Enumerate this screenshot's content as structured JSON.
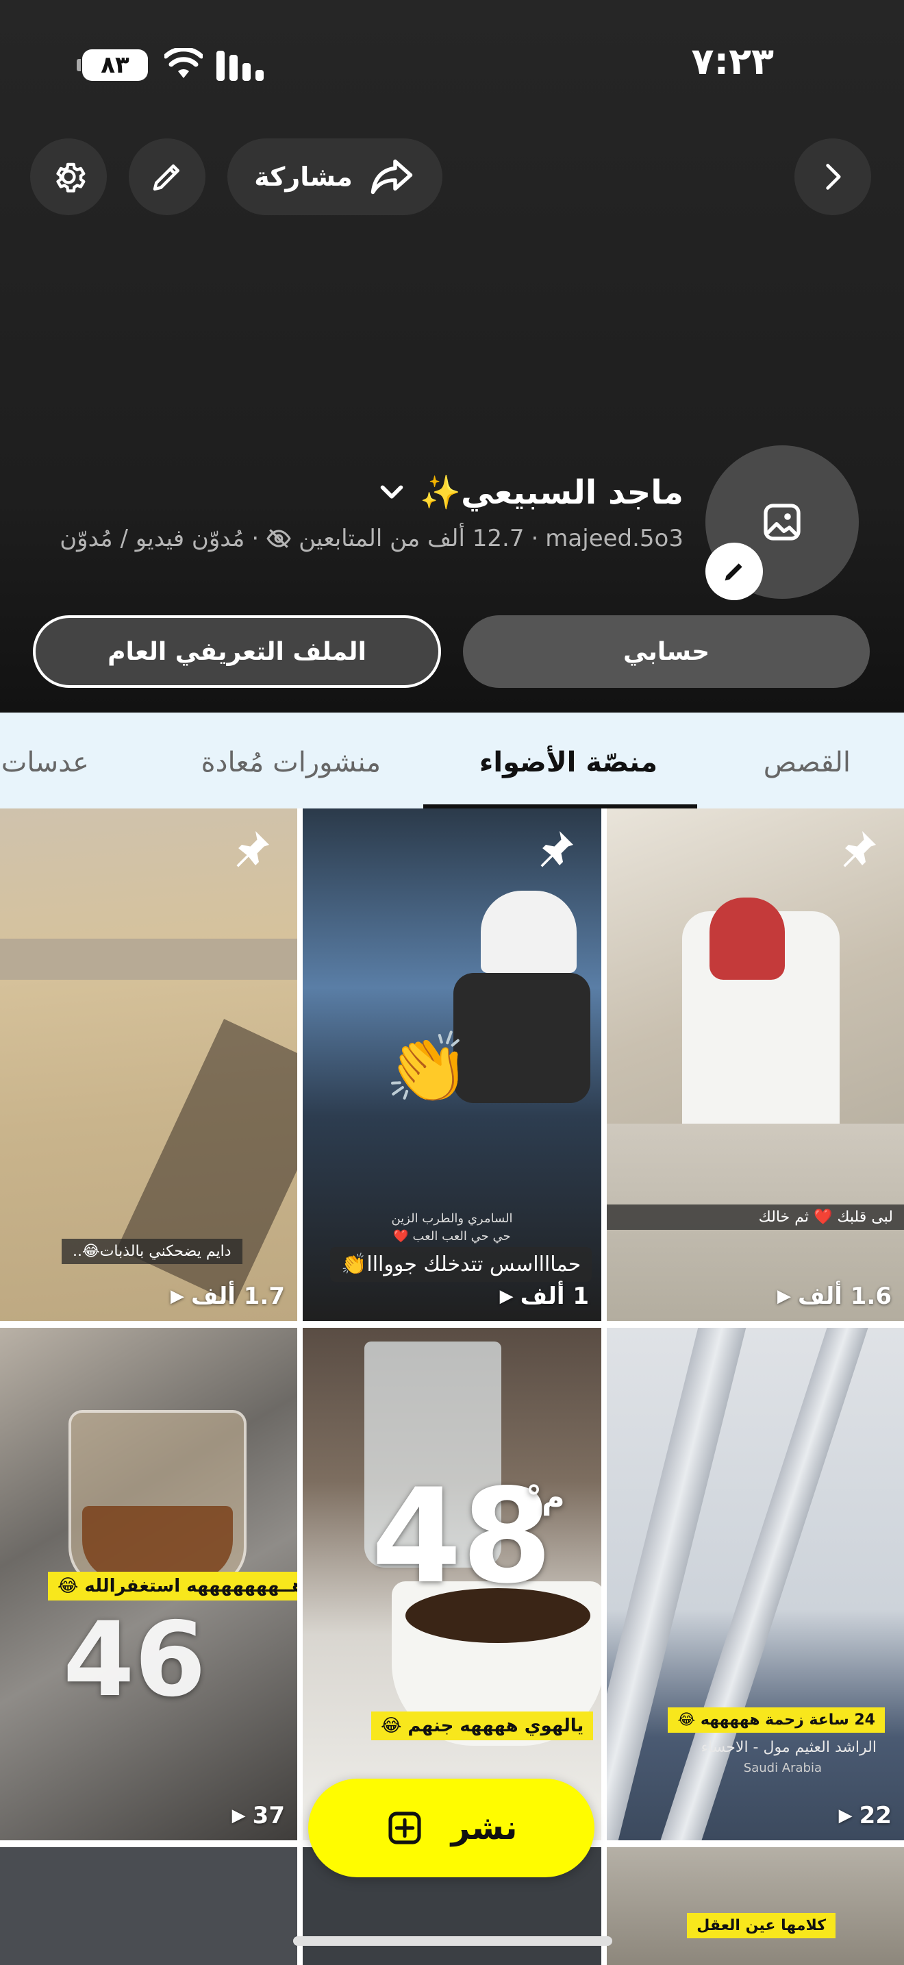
{
  "status_bar": {
    "time": "٧:٢٣",
    "battery": "٨٣"
  },
  "top_actions": {
    "share_label": "مشاركة"
  },
  "profile": {
    "name": "ماجد السبيعي✨",
    "username": "majeed.5o3",
    "followers": "12.7 ألف من المتابعين",
    "category": "مُدوّن فيديو / مُدوّن",
    "separator": "·"
  },
  "buttons": {
    "my_account": "حسابي",
    "public_profile": "الملف التعريفي العام"
  },
  "tabs": [
    {
      "label": "القصص"
    },
    {
      "label": "منصّة الأضواء"
    },
    {
      "label": "منشورات مُعادة"
    },
    {
      "label": "عدسات"
    }
  ],
  "tiles": [
    {
      "views": "1.6 ألف",
      "caption": "لبى قلبك ❤️ ثم خالك"
    },
    {
      "views": "1 ألف",
      "caption_top": "السامري والطرب الزين",
      "caption_mid": "حي حي العب العب ❤️",
      "caption": "حمااااسس تتدخلك جووااا👏"
    },
    {
      "views": "1.7 ألف",
      "caption": "دايم يضحكني بالذبات😂.."
    },
    {
      "views": "22",
      "caption": "24 ساعة زحمة هههههه 😂",
      "location": "الراشد العثيم مول - الاحساء",
      "country": "Saudi Arabia"
    },
    {
      "temp": "48",
      "unit": "°م",
      "caption": "يالهوي ههههه جنهم 😂"
    },
    {
      "views": "37",
      "temp": "46",
      "caption": "هــهههههههه استغفرالله 😂"
    },
    {
      "caption": "كلامها عين العقل"
    }
  ],
  "post_button": {
    "label": "نشر"
  },
  "colors": {
    "accent": "#fffc00",
    "header_bg": "#1e1e1e",
    "tabs_bg": "#e8f4fb"
  }
}
